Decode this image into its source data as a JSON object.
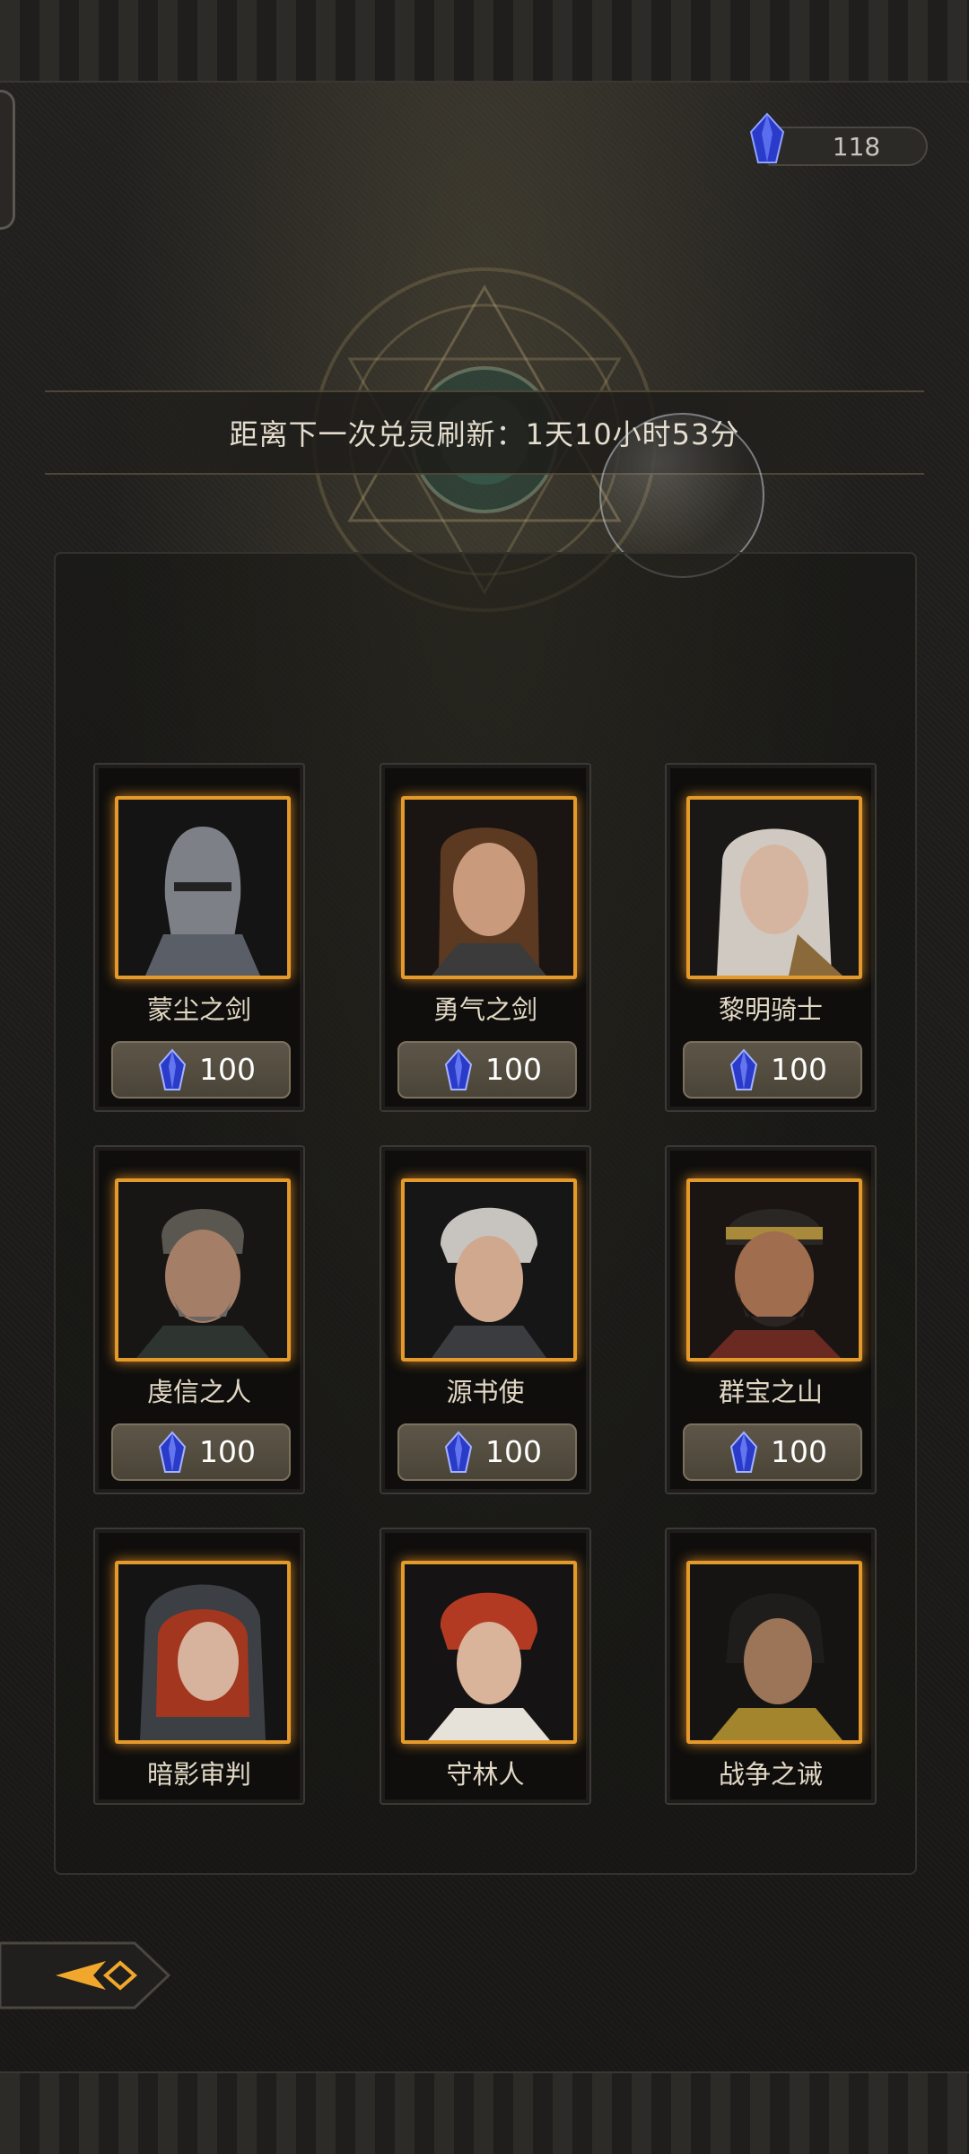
{
  "currency": {
    "icon": "blue-crystal-icon",
    "amount": "118"
  },
  "refresh": {
    "text": "距离下一次兑灵刷新：1天10小时53分"
  },
  "heroes": [
    {
      "name": "蒙尘之剑",
      "price": "100",
      "portrait": "armored-knight-helmet"
    },
    {
      "name": "勇气之剑",
      "price": "100",
      "portrait": "brown-haired-woman"
    },
    {
      "name": "黎明骑士",
      "price": "100",
      "portrait": "silver-haired-woman"
    },
    {
      "name": "虔信之人",
      "price": "100",
      "portrait": "gray-bearded-man"
    },
    {
      "name": "源书使",
      "price": "100",
      "portrait": "white-haired-youth"
    },
    {
      "name": "群宝之山",
      "price": "100",
      "portrait": "bearded-warrior-headband"
    },
    {
      "name": "暗影审判",
      "price": "",
      "portrait": "hooded-red-haired-woman"
    },
    {
      "name": "守林人",
      "price": "",
      "portrait": "red-haired-youth"
    },
    {
      "name": "战争之诫",
      "price": "",
      "portrait": "dark-haired-swordsman"
    }
  ],
  "colors": {
    "frame_glow": "#e39a2a",
    "crystal": "#3b4fd8",
    "price_button": "#544d40",
    "background": "#1b1a18"
  },
  "back": {
    "icon": "back-arrow-icon"
  }
}
